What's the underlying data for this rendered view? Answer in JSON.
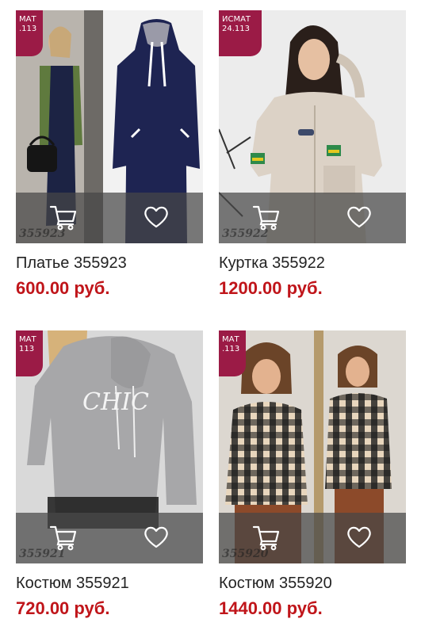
{
  "products": [
    {
      "name": "Платье 355923",
      "price": "600.00 руб.",
      "badge_line1": "МАТ",
      "badge_line2": ".113",
      "watermark": "355923",
      "cart_icon": "cart-icon",
      "favorite_icon": "heart-icon"
    },
    {
      "name": "Куртка 355922",
      "price": "1200.00 руб.",
      "badge_line1": "ИСМАТ",
      "badge_line2": "24.113",
      "watermark": "355922",
      "cart_icon": "cart-icon",
      "favorite_icon": "heart-icon"
    },
    {
      "name": "Костюм 355921",
      "price": "720.00 руб.",
      "badge_line1": "МАТ",
      "badge_line2": "113",
      "watermark": "355921",
      "cart_icon": "cart-icon",
      "favorite_icon": "heart-icon"
    },
    {
      "name": "Костюм 355920",
      "price": "1440.00 руб.",
      "badge_line1": "МАТ",
      "badge_line2": ".113",
      "watermark": "355920",
      "cart_icon": "cart-icon",
      "favorite_icon": "heart-icon"
    }
  ],
  "colors": {
    "price": "#c0151a",
    "badge": "#9b1b46",
    "overlay": "#464646"
  }
}
